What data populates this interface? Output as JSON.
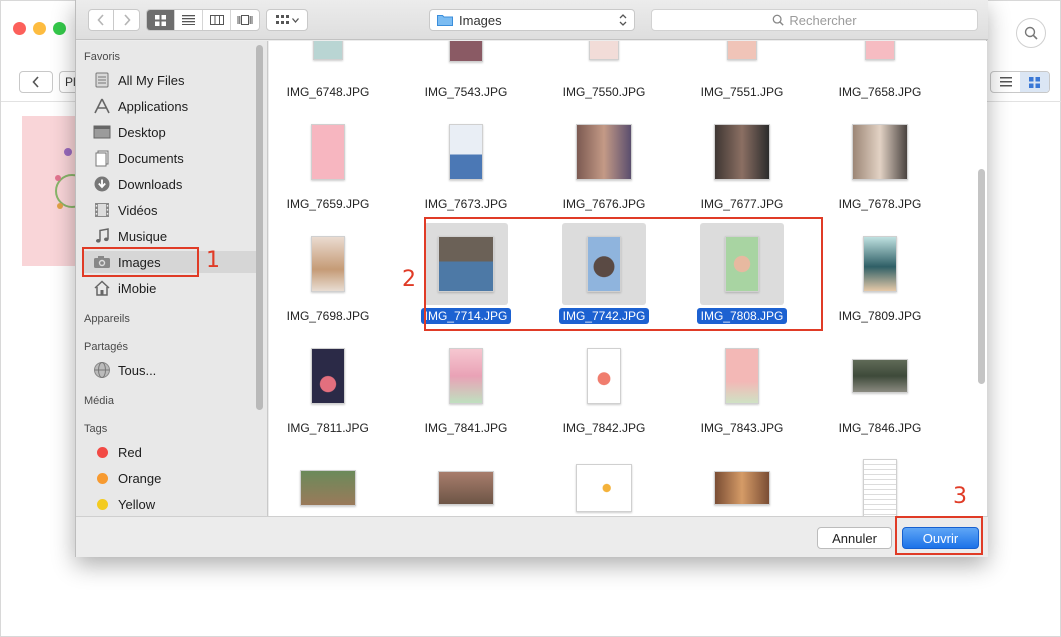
{
  "background_app": {
    "crumb_text": "Pl"
  },
  "toolbar": {
    "location": "Images",
    "search_placeholder": "Rechercher"
  },
  "sidebar": {
    "favorites_header": "Favoris",
    "favorites": [
      {
        "label": "All My Files",
        "icon": "all-files-icon"
      },
      {
        "label": "Applications",
        "icon": "applications-icon"
      },
      {
        "label": "Desktop",
        "icon": "desktop-icon"
      },
      {
        "label": "Documents",
        "icon": "documents-icon"
      },
      {
        "label": "Downloads",
        "icon": "downloads-icon"
      },
      {
        "label": "Vidéos",
        "icon": "videos-icon"
      },
      {
        "label": "Musique",
        "icon": "music-icon"
      },
      {
        "label": "Images",
        "icon": "camera-icon"
      },
      {
        "label": "iMobie",
        "icon": "home-icon"
      }
    ],
    "devices_header": "Appareils",
    "shared_header": "Partagés",
    "shared": [
      {
        "label": "Tous...",
        "icon": "network-icon"
      }
    ],
    "media_header": "Média",
    "tags_header": "Tags",
    "tags": [
      {
        "label": "Red",
        "color": "#f24a45"
      },
      {
        "label": "Orange",
        "color": "#f79a30"
      },
      {
        "label": "Yellow",
        "color": "#f3cb1f"
      }
    ]
  },
  "files": [
    {
      "name": "IMG_6748.JPG",
      "selected": false
    },
    {
      "name": "IMG_7543.JPG",
      "selected": false
    },
    {
      "name": "IMG_7550.JPG",
      "selected": false
    },
    {
      "name": "IMG_7551.JPG",
      "selected": false
    },
    {
      "name": "IMG_7658.JPG",
      "selected": false
    },
    {
      "name": "IMG_7659.JPG",
      "selected": false
    },
    {
      "name": "IMG_7673.JPG",
      "selected": false
    },
    {
      "name": "IMG_7676.JPG",
      "selected": false
    },
    {
      "name": "IMG_7677.JPG",
      "selected": false
    },
    {
      "name": "IMG_7678.JPG",
      "selected": false
    },
    {
      "name": "IMG_7698.JPG",
      "selected": false
    },
    {
      "name": "IMG_7714.JPG",
      "selected": true
    },
    {
      "name": "IMG_7742.JPG",
      "selected": true
    },
    {
      "name": "IMG_7808.JPG",
      "selected": true
    },
    {
      "name": "IMG_7809.JPG",
      "selected": false
    },
    {
      "name": "IMG_7811.JPG",
      "selected": false
    },
    {
      "name": "IMG_7841.JPG",
      "selected": false
    },
    {
      "name": "IMG_7842.JPG",
      "selected": false
    },
    {
      "name": "IMG_7843.JPG",
      "selected": false
    },
    {
      "name": "IMG_7846.JPG",
      "selected": false
    }
  ],
  "footer": {
    "cancel_label": "Annuler",
    "open_label": "Ouvrir"
  },
  "annotations": {
    "step1": "1",
    "step2": "2",
    "step3": "3",
    "color": "#e03b26"
  }
}
